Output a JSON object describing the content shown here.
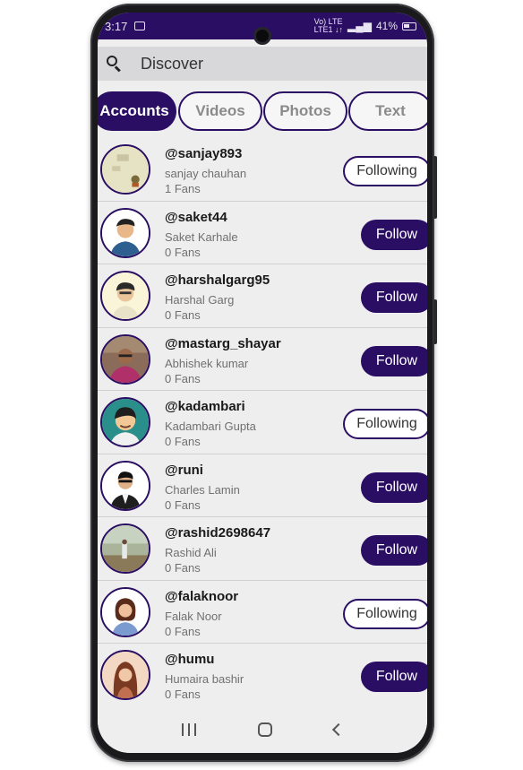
{
  "status": {
    "time": "3:17",
    "network": "Vo) LTE\nLTE1 ↓↑",
    "battery": "41%"
  },
  "search": {
    "label": "Discover"
  },
  "tabs": [
    "Accounts",
    "Videos",
    "Photos",
    "Text"
  ],
  "active_tab": "Accounts",
  "accounts": [
    {
      "handle": "@sanjay893",
      "name": "sanjay chauhan",
      "fans": "1 Fans",
      "button": "Following"
    },
    {
      "handle": "@saket44",
      "name": "Saket Karhale",
      "fans": "0 Fans",
      "button": "Follow"
    },
    {
      "handle": "@harshalgarg95",
      "name": "Harshal Garg",
      "fans": "0 Fans",
      "button": "Follow"
    },
    {
      "handle": "@mastarg_shayar",
      "name": "Abhishek kumar",
      "fans": "0 Fans",
      "button": "Follow"
    },
    {
      "handle": "@kadambari",
      "name": "Kadambari Gupta",
      "fans": "0 Fans",
      "button": "Following"
    },
    {
      "handle": "@runi",
      "name": "Charles Lamin",
      "fans": "0 Fans",
      "button": "Follow"
    },
    {
      "handle": "@rashid2698647",
      "name": "Rashid Ali",
      "fans": "0 Fans",
      "button": "Follow"
    },
    {
      "handle": "@falaknoor",
      "name": "Falak Noor",
      "fans": "0 Fans",
      "button": "Following"
    },
    {
      "handle": "@humu",
      "name": "Humaira bashir",
      "fans": "0 Fans",
      "button": "Follow"
    }
  ],
  "colors": {
    "accent": "#2a0e63",
    "background": "#eeeeef"
  },
  "icons": {
    "search": "search-icon",
    "recent": "recent-apps-icon",
    "home": "home-icon",
    "back": "back-icon"
  }
}
